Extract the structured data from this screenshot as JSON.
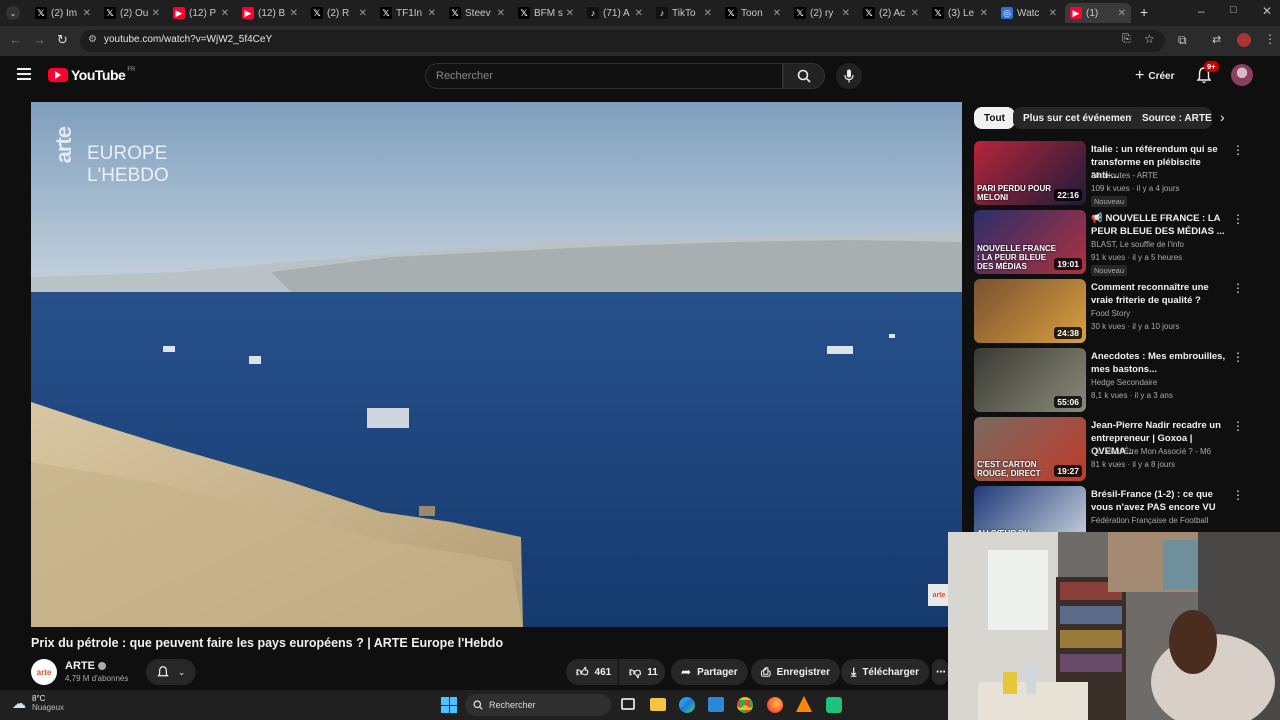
{
  "browser": {
    "tabs": [
      {
        "icon": "x-icon",
        "label": "(2) Im"
      },
      {
        "icon": "x-icon",
        "label": "(2) Ou"
      },
      {
        "icon": "youtube-icon",
        "label": "(12) P"
      },
      {
        "icon": "youtube-icon",
        "label": "(12) B"
      },
      {
        "icon": "x-icon",
        "label": "(2) R"
      },
      {
        "icon": "x-icon",
        "label": "TF1In"
      },
      {
        "icon": "x-icon",
        "label": "Steev"
      },
      {
        "icon": "x-icon",
        "label": "BFM s"
      },
      {
        "icon": "tiktok-icon",
        "label": "(71) A"
      },
      {
        "icon": "tiktok-icon",
        "label": "TikTo"
      },
      {
        "icon": "x-icon",
        "label": "Toon"
      },
      {
        "icon": "x-icon",
        "label": "(2) ry"
      },
      {
        "icon": "x-icon",
        "label": "(2) Ac"
      },
      {
        "icon": "x-icon",
        "label": "(3) Le"
      },
      {
        "icon": "globe-icon",
        "label": "Watc"
      },
      {
        "icon": "youtube-icon",
        "label": "(1)"
      }
    ],
    "url": "youtube.com/watch?v=WjW2_5f4CeY"
  },
  "youtube": {
    "logo": "YouTube",
    "region": "FR",
    "search_placeholder": "Rechercher",
    "create_label": "Créer",
    "notif_count": "9+"
  },
  "video": {
    "overlay_line1": "EUROPE",
    "overlay_line2": "L'HEBDO",
    "overlay_brand": "arte",
    "title": "Prix du pétrole : que peuvent faire les pays européens ? | ARTE Europe l'Hebdo",
    "channel": "ARTE",
    "subscribers": "4,79 M d'abonnés",
    "avatar_text": "arte",
    "likes": "461",
    "dislikes": "11",
    "share": "Partager",
    "save": "Enregistrer",
    "download": "Télécharger"
  },
  "chips": [
    "Tout",
    "Plus sur cet événement",
    "Source : ARTE"
  ],
  "recommendations": [
    {
      "title": "Italie : un référendum qui se transforme en plébiscite anti-...",
      "channel": "28 minutes - ARTE",
      "meta": "109 k vues · il y a 4 jours",
      "badge": "Nouveau",
      "duration": "22:16",
      "thumb_text": "PARI PERDU POUR MELONI"
    },
    {
      "title": "📢 NOUVELLE FRANCE : LA PEUR BLEUE DES MÉDIAS ...",
      "channel": "BLAST, Le souffle de l'info",
      "meta": "91 k vues · il y a 5 heures",
      "badge": "Nouveau",
      "duration": "19:01",
      "thumb_text": "NOUVELLE FRANCE : LA PEUR BLEUE DES MÉDIAS"
    },
    {
      "title": "Comment reconnaître une vraie friterie de qualité ?",
      "channel": "Food Story",
      "meta": "30 k vues · il y a 10 jours",
      "badge": "",
      "duration": "24:38",
      "thumb_text": ""
    },
    {
      "title": "Anecdotes : Mes embrouilles, mes bastons...",
      "channel": "Hedge Secondaire",
      "meta": "8,1 k vues · il y a 3 ans",
      "badge": "",
      "duration": "55:06",
      "thumb_text": ""
    },
    {
      "title": "Jean-Pierre Nadir recadre un entrepreneur | Goxoa | QVEMA...",
      "channel": "Qui Veut Être Mon Associé ? - M6",
      "meta": "81 k vues · il y a 8 jours",
      "badge": "",
      "duration": "19:27",
      "thumb_text": "C'EST CARTON ROUGE, DIRECT"
    },
    {
      "title": "Brésil-France (1-2) : ce que vous n'avez PAS encore VU",
      "channel": "Fédération Française de Football",
      "meta": "",
      "badge": "",
      "duration": "",
      "thumb_text": "AU CŒUR DU VESTIAIRE"
    }
  ],
  "taskbar": {
    "temperature": "8°C",
    "weather": "Nuageux",
    "search": "Rechercher"
  },
  "colors": {
    "youtube_red": "#ff0033",
    "background": "#0f0f0f",
    "chip": "#272727"
  }
}
